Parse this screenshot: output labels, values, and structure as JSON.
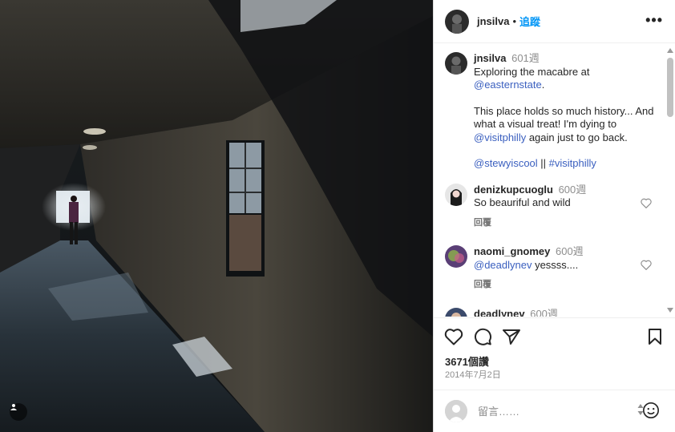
{
  "post": {
    "author": "jnsilva",
    "follow_label": "追蹤",
    "separator": "•",
    "more_label": "•••"
  },
  "caption": {
    "user": "jnsilva",
    "time": "601週",
    "line1": "Exploring the macabre at",
    "mention1": "@easternstate",
    "line1_end": ".",
    "line2": "This place holds so much history... And what a visual treat!  I'm dying to",
    "mention2": "@visitphilly",
    "line2_end": " again just to go back.",
    "mention3": "@stewyiscool",
    "bars": " || ",
    "hashtag": "#visitphilly"
  },
  "comments": [
    {
      "user": "denizkupcuoglu",
      "time": "600週",
      "text": "So beauriful and wild",
      "mention": "",
      "reply": "回覆",
      "avatar_color": "#d9d9d9"
    },
    {
      "user": "naomi_gnomey",
      "time": "600週",
      "mention": "@deadlynev",
      "text": " yessss....",
      "reply": "回覆",
      "avatar_color": "#5a3f76"
    },
    {
      "user": "deadlynev",
      "time": "600週"
    }
  ],
  "engagement": {
    "likes": "3671個讚",
    "date": "2014年7月2日"
  },
  "composer": {
    "placeholder": "留言……"
  },
  "icons": {
    "heart": "heart-icon",
    "comment": "comment-icon",
    "share": "share-icon",
    "save": "bookmark-icon",
    "emoji": "emoji-icon",
    "tag": "user-tag-icon"
  },
  "colors": {
    "link": "#3a5fbf",
    "follow": "#0095f6",
    "muted": "#8e8e8e"
  }
}
